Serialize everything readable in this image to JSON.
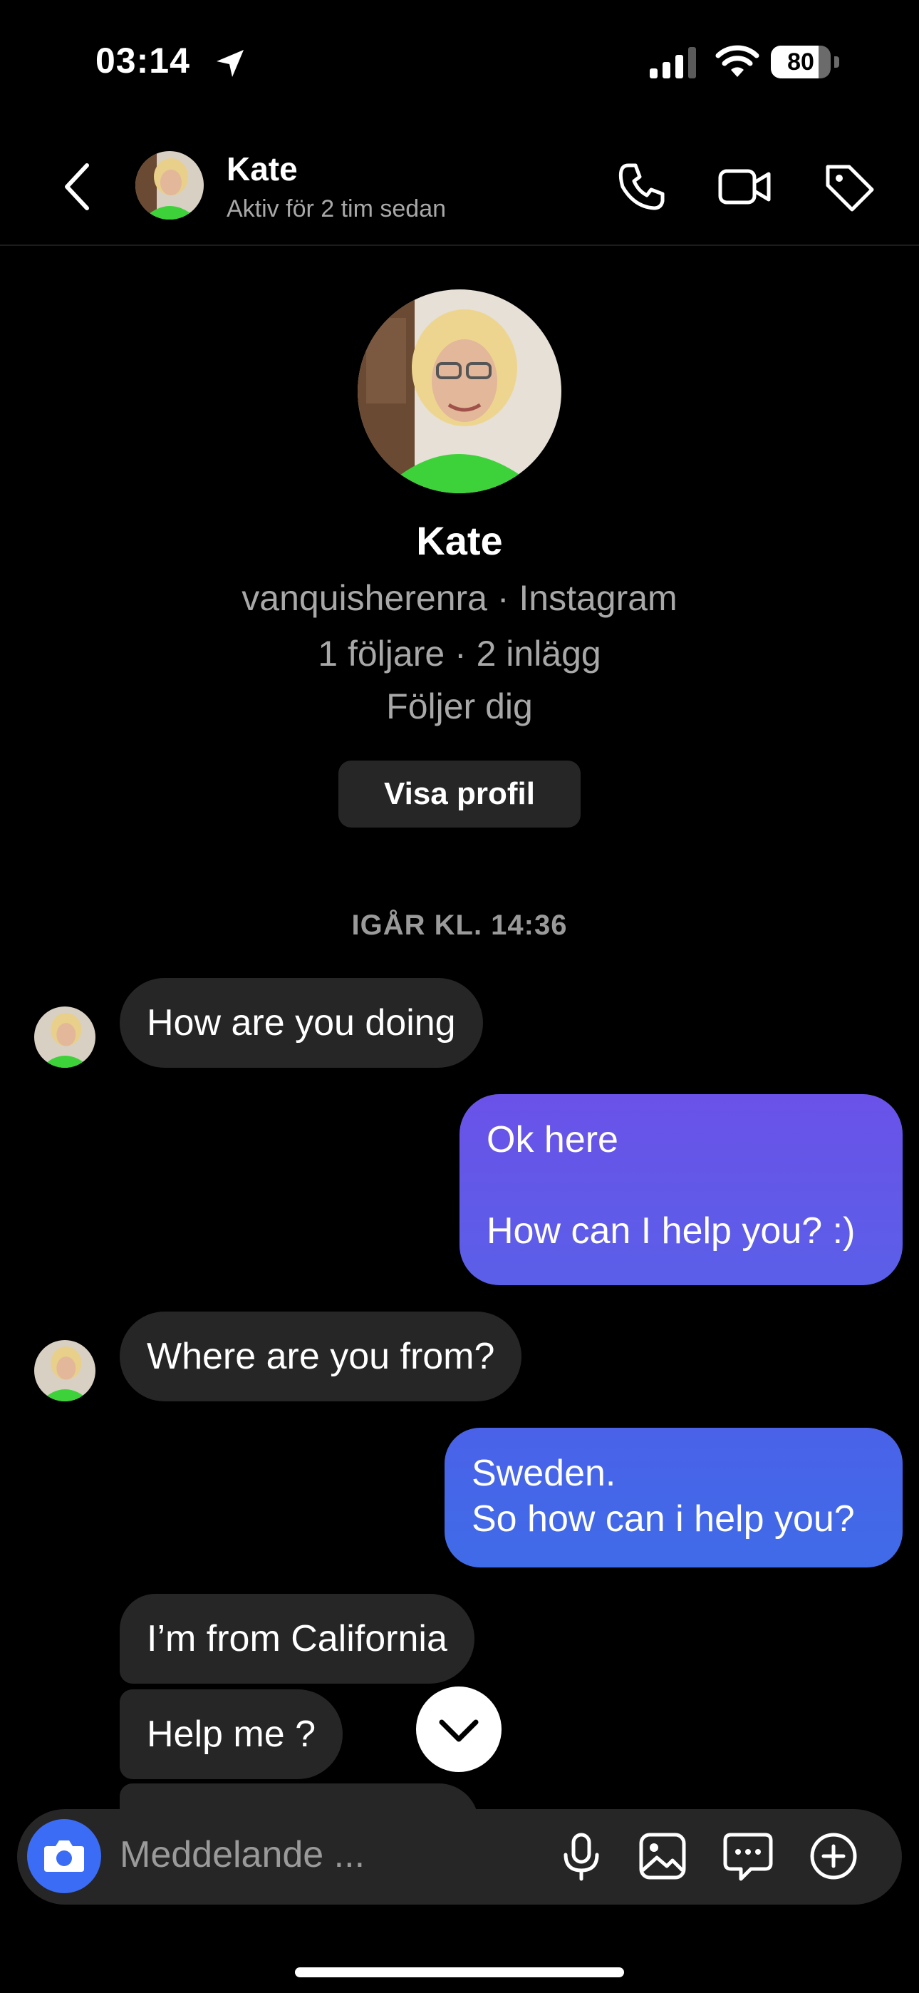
{
  "status_bar": {
    "time": "03:14",
    "battery": "80",
    "battery_level": 0.8
  },
  "header": {
    "name": "Kate",
    "subtitle": "Aktiv för 2 tim sedan"
  },
  "profile": {
    "name": "Kate",
    "handle_line": "vanquisherenra · Instagram",
    "stats_line": "1 följare · 2 inlägg",
    "follow_line": "Följer dig",
    "view_profile_label": "Visa profil"
  },
  "chat": {
    "date_stamp": "IGÅR KL. 14:36",
    "messages": [
      {
        "from": "them",
        "text": "How are you doing"
      },
      {
        "from": "me",
        "text": "Ok here\n\nHow can I help you? :)"
      },
      {
        "from": "them",
        "text": "Where are you from?"
      },
      {
        "from": "me",
        "text": "Sweden.\nSo how can i help you?"
      },
      {
        "from": "them",
        "text": "I’m from California"
      },
      {
        "from": "them",
        "text": "Help me ?"
      }
    ]
  },
  "composer": {
    "placeholder": "Meddelande ..."
  },
  "colors": {
    "outgoing_top": "#6a52e8",
    "outgoing_bottom": "#3f6be8",
    "incoming": "#262626",
    "camera_button": "#3b6cf6"
  }
}
